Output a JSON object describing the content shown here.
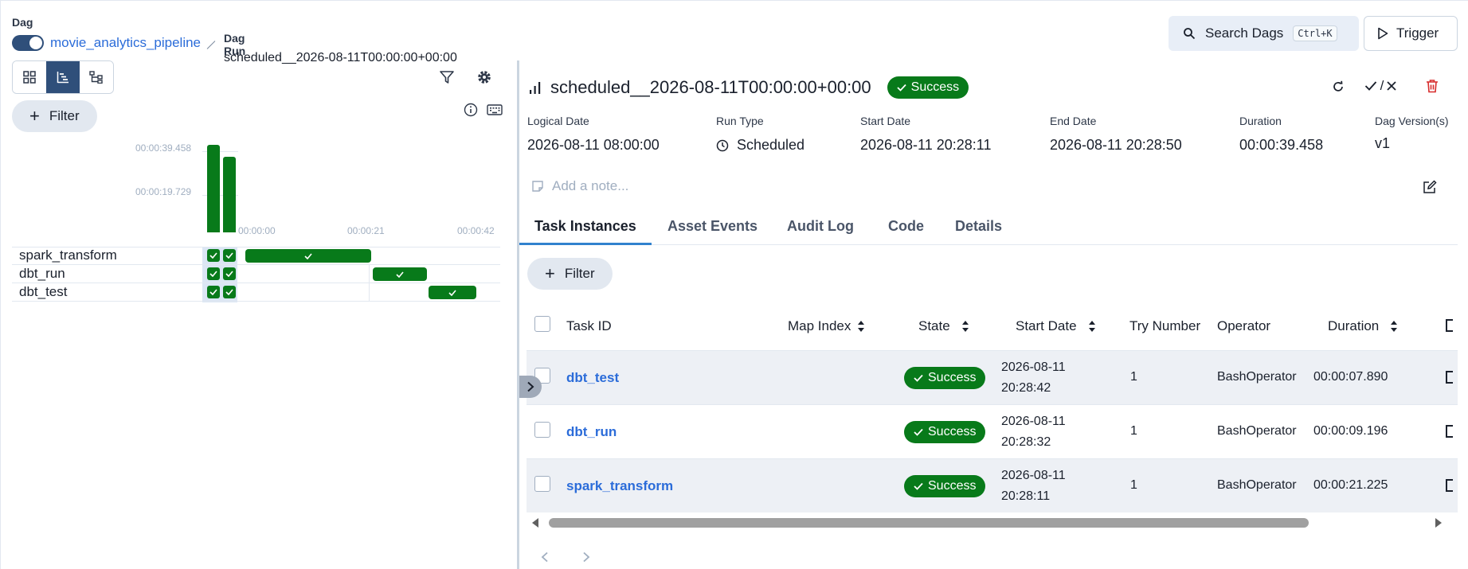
{
  "header": {
    "dag_label": "Dag",
    "dag_name": "movie_analytics_pipeline",
    "run_label": "Dag Run",
    "run_name": "scheduled__2026-08-11T00:00:00+00:00",
    "search_label": "Search Dags",
    "search_shortcut": "Ctrl+K",
    "trigger_label": "Trigger"
  },
  "left_panel": {
    "filter_label": "Filter",
    "y_ticks": [
      "00:00:39.458",
      "00:00:19.729"
    ],
    "x_ticks": [
      "00:00:00",
      "00:00:21",
      "00:00:42"
    ],
    "tasks": [
      "spark_transform",
      "dbt_run",
      "dbt_test"
    ]
  },
  "chart_data": {
    "type": "bar",
    "title": "",
    "duration_bars": {
      "y_ticks": [
        "00:00:39.458",
        "00:00:19.729"
      ],
      "values_seconds": [
        39.458,
        33.5
      ]
    },
    "gantt": {
      "x_ticks": [
        "00:00:00",
        "00:00:21",
        "00:00:42"
      ],
      "tasks": [
        {
          "name": "spark_transform",
          "start_s": 0,
          "end_s": 21.225
        },
        {
          "name": "dbt_run",
          "start_s": 21.5,
          "end_s": 30.7
        },
        {
          "name": "dbt_test",
          "start_s": 31.0,
          "end_s": 39.0
        }
      ]
    }
  },
  "run": {
    "title": "scheduled__2026-08-11T00:00:00+00:00",
    "state": "Success",
    "meta": [
      {
        "label": "Logical Date",
        "value": "2026-08-11 08:00:00"
      },
      {
        "label": "Run Type",
        "value": "Scheduled"
      },
      {
        "label": "Start Date",
        "value": "2026-08-11 20:28:11"
      },
      {
        "label": "End Date",
        "value": "2026-08-11 20:28:50"
      },
      {
        "label": "Duration",
        "value": "00:00:39.458"
      },
      {
        "label": "Dag Version(s)",
        "value": "v1"
      }
    ],
    "note_placeholder": "Add a note...",
    "mark_label": "/"
  },
  "tabs": [
    "Task Instances",
    "Asset Events",
    "Audit Log",
    "Code",
    "Details"
  ],
  "table": {
    "filter_label": "Filter",
    "columns": [
      "Task ID",
      "Map Index",
      "State",
      "Start Date",
      "Try Number",
      "Operator",
      "Duration"
    ],
    "rows": [
      {
        "task_id": "dbt_test",
        "map_index": "",
        "state": "Success",
        "start_line1": "2026-08-11",
        "start_line2": "20:28:42",
        "try": "1",
        "operator": "BashOperator",
        "duration": "00:00:07.890"
      },
      {
        "task_id": "dbt_run",
        "map_index": "",
        "state": "Success",
        "start_line1": "2026-08-11",
        "start_line2": "20:28:32",
        "try": "1",
        "operator": "BashOperator",
        "duration": "00:00:09.196"
      },
      {
        "task_id": "spark_transform",
        "map_index": "",
        "state": "Success",
        "start_line1": "2026-08-11",
        "start_line2": "20:28:11",
        "try": "1",
        "operator": "BashOperator",
        "duration": "00:00:21.225"
      }
    ]
  },
  "colors": {
    "success": "#087a1a",
    "accent": "#2f4f7a",
    "link": "#2b6cd9"
  }
}
